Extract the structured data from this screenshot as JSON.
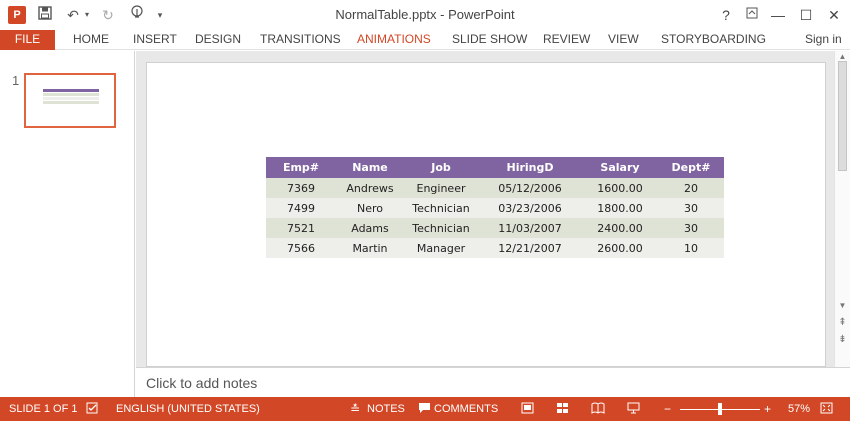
{
  "window": {
    "title": "NormalTable.pptx - PowerPoint",
    "app_icon_letter": "P",
    "controls": {
      "help": "?",
      "ribbon_display": "⧉",
      "minimize": "—",
      "maximize": "☐",
      "close": "✕"
    }
  },
  "quick_access": {
    "save_icon": "save-icon",
    "undo_icon": "undo-icon",
    "redo_icon": "redo-icon",
    "touch_mode_icon": "touch-mode-icon",
    "customize_icon": "customize-icon"
  },
  "ribbon": {
    "file_tab": "FILE",
    "tabs": [
      "HOME",
      "INSERT",
      "DESIGN",
      "TRANSITIONS",
      "ANIMATIONS",
      "SLIDE SHOW",
      "REVIEW",
      "VIEW",
      "STORYBOARDING"
    ],
    "active_tab": "ANIMATIONS",
    "sign_in": "Sign in",
    "accent_color": "#d24726"
  },
  "thumbnails": {
    "slide_number": "1"
  },
  "table": {
    "headers": [
      "Emp#",
      "Name",
      "Job",
      "HiringD",
      "Salary",
      "Dept#"
    ],
    "rows": [
      [
        "7369",
        "Andrews",
        "Engineer",
        "05/12/2006",
        "1600.00",
        "20"
      ],
      [
        "7499",
        "Nero",
        "Technician",
        "03/23/2006",
        "1800.00",
        "30"
      ],
      [
        "7521",
        "Adams",
        "Technician",
        "11/03/2007",
        "2400.00",
        "30"
      ],
      [
        "7566",
        "Martin",
        "Manager",
        "12/21/2007",
        "2600.00",
        "10"
      ]
    ],
    "header_color": "#8064a2",
    "band_color_1": "#dfe3d6",
    "band_color_2": "#eeefeb"
  },
  "notes": {
    "placeholder": "Click to add notes"
  },
  "status": {
    "slide": "SLIDE 1 OF 1",
    "language": "ENGLISH (UNITED STATES)",
    "notes": "NOTES",
    "comments": "COMMENTS",
    "zoom": "57%",
    "zoom_level": 0.57
  }
}
